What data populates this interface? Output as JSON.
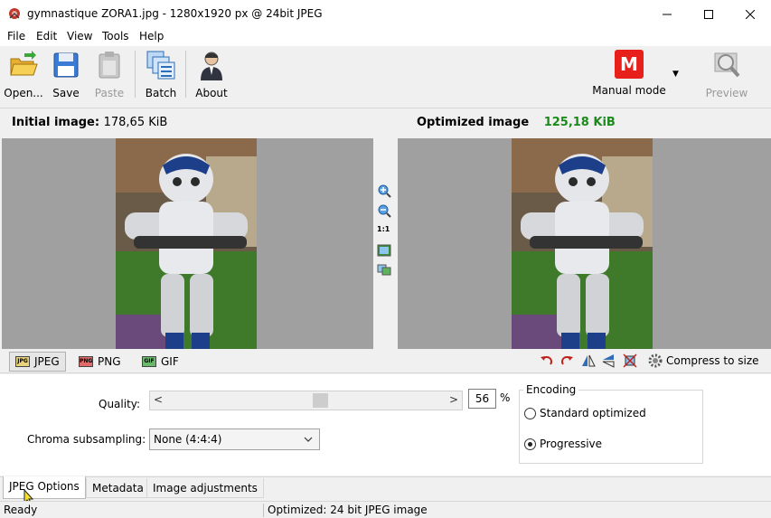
{
  "window": {
    "title": "gymnastique ZORA1.jpg - 1280x1920 px @ 24bit JPEG",
    "minimize_icon": "minimize-icon",
    "maximize_icon": "maximize-icon",
    "close_icon": "close-icon"
  },
  "menu": [
    "File",
    "Edit",
    "View",
    "Tools",
    "Help"
  ],
  "toolbar": {
    "open": "Open...",
    "save": "Save",
    "paste": "Paste",
    "batch": "Batch",
    "about": "About",
    "mode_letter": "M",
    "mode": "Manual mode",
    "preview": "Preview"
  },
  "headers": {
    "initial_label": "Initial image:",
    "initial_size": "178,65 KiB",
    "optimized_label": "Optimized image",
    "optimized_size": "125,18 KiB"
  },
  "zoom_tools": {
    "one_to_one": "1:1"
  },
  "format_tabs": {
    "jpeg": "JPEG",
    "png": "PNG",
    "gif": "GIF",
    "jpeg_icon_text": "JPG",
    "png_icon_text": "PNG",
    "gif_icon_text": "GIF",
    "compress_to_size": "Compress to size"
  },
  "jpeg_options": {
    "quality_label": "Quality:",
    "quality_value": "56",
    "quality_fraction": 0.56,
    "percent": "%",
    "chroma_label": "Chroma subsampling:",
    "chroma_value": "None (4:4:4)",
    "encoding_legend": "Encoding",
    "standard_label": "Standard optimized",
    "progressive_label": "Progressive",
    "selected_encoding": "Progressive"
  },
  "bottom_tabs": [
    "JPEG Options",
    "Metadata",
    "Image adjustments"
  ],
  "status": {
    "left": "Ready",
    "right": "Optimized: 24 bit JPEG image"
  },
  "colors": {
    "mode_badge": "#e8201c",
    "optimized_size": "#1b8a1b",
    "pane_background": "#a0a0a0"
  }
}
